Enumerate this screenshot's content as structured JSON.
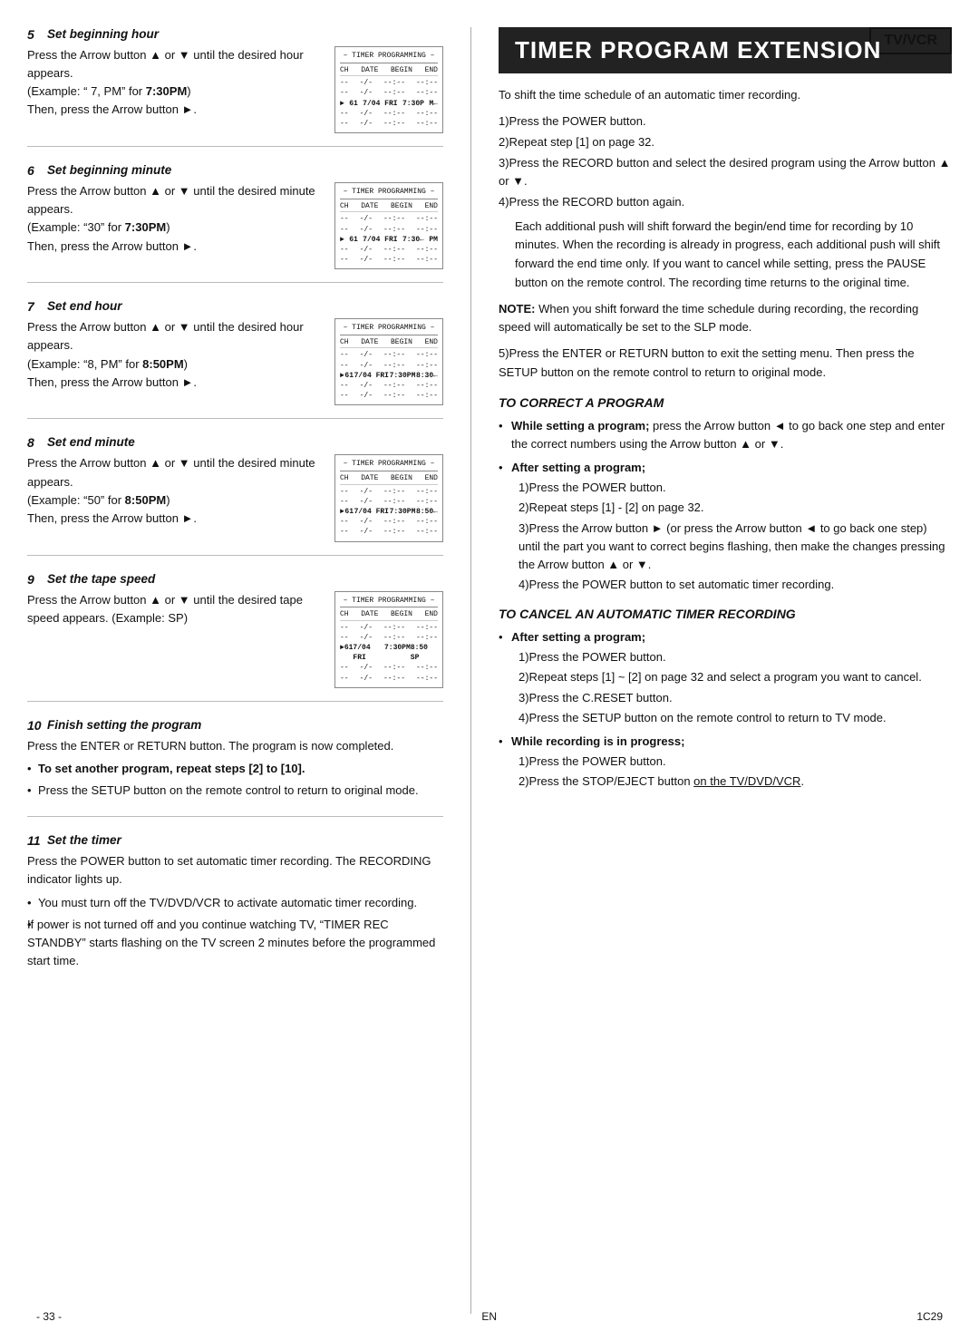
{
  "page": {
    "title": "TIMER PROGRAM EXTENSION",
    "badge": "TV/VCR",
    "page_number": "- 33 -",
    "language": "EN",
    "code": "1C29"
  },
  "left_column": {
    "steps": [
      {
        "num": "5",
        "title": "Set beginning hour",
        "text_lines": [
          "Press the Arrow button ▲ or ▼ until the desired hour appears.",
          "(Example: \" 7, PM\" for 7:30PM)",
          "Then, press the Arrow button ►."
        ],
        "screen": {
          "title": "– TIMER PROGRAMMING –",
          "header": [
            "CH",
            "DATE",
            "BEGIN",
            "END"
          ],
          "rows": [
            [
              "--",
              "-/-",
              "- -:- -",
              "- -:- -"
            ],
            [
              "--",
              "-/-",
              "- -:- -",
              "- -:- -"
            ],
            [
              "61",
              "7/04 FRI",
              "7:30P",
              "M ←"
            ],
            [
              "--",
              "-/-",
              "- -:- -",
              "- -:- -"
            ],
            [
              "--",
              "-/-",
              "- -:- -",
              "- -:- -"
            ]
          ],
          "highlighted_row": 2
        }
      },
      {
        "num": "6",
        "title": "Set beginning minute",
        "text_lines": [
          "Press the Arrow button ▲ or ▼ until the desired minute appears.",
          "(Example: \"30\" for 7:30PM)",
          "Then, press the Arrow button ►."
        ],
        "screen": {
          "title": "– TIMER PROGRAMMING –",
          "header": [
            "CH",
            "DATE",
            "BEGIN",
            "END"
          ],
          "rows": [
            [
              "--",
              "-/-",
              "- -:- -",
              "- -:- -"
            ],
            [
              "--",
              "-/-",
              "- -:- -",
              "- -:- -"
            ],
            [
              "61",
              "7/04 FRI",
              "7:30P",
              "M ←"
            ],
            [
              "--",
              "-/-",
              "- -:- -",
              "- -:- -"
            ],
            [
              "--",
              "-/-",
              "- -:- -",
              "- -:- -"
            ]
          ],
          "highlighted_row": 2
        }
      },
      {
        "num": "7",
        "title": "Set end hour",
        "text_lines": [
          "Press the Arrow button ▲ or ▼ until the desired hour appears.",
          "(Example: \"8, PM\" for 8:50PM)",
          "Then, press the Arrow button ►."
        ],
        "screen": {
          "title": "– TIMER PROGRAMMING –",
          "header": [
            "CH",
            "DATE",
            "BEGIN",
            "END"
          ],
          "rows": [
            [
              "--",
              "-/-",
              "- -:- -",
              "- -:- -"
            ],
            [
              "--",
              "-/-",
              "- -:- -",
              "- -:- -"
            ],
            [
              "61",
              "7/04 FRI",
              "7:30P",
              "M 8:30"
            ],
            [
              "--",
              "-/-",
              "- -:- -",
              "- -:- -"
            ],
            [
              "--",
              "-/-",
              "- -:- -",
              "- -:- -"
            ]
          ],
          "highlighted_row": 2
        }
      },
      {
        "num": "8",
        "title": "Set end minute",
        "text_lines": [
          "Press the Arrow button ▲ or ▼ until the desired minute appears.",
          "(Example: \"50\" for 8:50PM)",
          "Then, press the Arrow button ►."
        ],
        "screen": {
          "title": "– TIMER PROGRAMMING –",
          "header": [
            "CH",
            "DATE",
            "BEGIN",
            "END"
          ],
          "rows": [
            [
              "--",
              "-/-",
              "- -:- -",
              "- -:- -"
            ],
            [
              "--",
              "-/-",
              "- -:- -",
              "- -:- -"
            ],
            [
              "61",
              "7/04 FRI",
              "7:30P",
              "M 8:50"
            ],
            [
              "--",
              "-/-",
              "- -:- -",
              "- -:- -"
            ],
            [
              "--",
              "-/-",
              "- -:- -",
              "- -:- -"
            ]
          ],
          "highlighted_row": 2
        }
      },
      {
        "num": "9",
        "title": "Set the tape speed",
        "text_lines": [
          "Press the Arrow button ▲ or ▼ until the desired tape speed appears. (Example: SP)"
        ],
        "screen": {
          "title": "– TIMER PROGRAMMING –",
          "header": [
            "CH",
            "DATE",
            "BEGIN",
            "END"
          ],
          "rows": [
            [
              "--",
              "-/-",
              "- -:- -",
              "- -:- -"
            ],
            [
              "--",
              "-/-",
              "- -:- -",
              "- -:- -"
            ],
            [
              "61",
              "7/04 FRI",
              "7:30P",
              "M 8:50 SP"
            ],
            [
              "--",
              "-/-",
              "- -:- -",
              "- -:- -"
            ],
            [
              "--",
              "-/-",
              "- -:- -",
              "- -:- -"
            ]
          ],
          "highlighted_row": 2
        }
      }
    ],
    "step10": {
      "num": "10",
      "title": "Finish setting the program",
      "text": "Press the ENTER or RETURN button. The program is now completed.",
      "bullets": [
        "To set another program, repeat steps [2] to [10].",
        "Press the SETUP button on the remote control to return to original mode."
      ]
    },
    "step11": {
      "num": "11",
      "title": "Set the timer",
      "text": "Press the POWER button to set automatic timer recording. The RECORDING indicator lights up.",
      "bullets": [
        "You must turn off the TV/DVD/VCR to activate automatic timer recording.",
        "If power is not turned off and you continue watching TV, \"TIMER REC STANDBY\" starts flashing on the TV screen 2 minutes before the programmed start time."
      ]
    }
  },
  "right_column": {
    "intro_text": "To shift the time schedule of an automatic timer recording.",
    "numbered_steps": [
      "1)Press the POWER button.",
      "2)Repeat step [1] on page 32.",
      "3)Press the RECORD button and select the desired program using the Arrow button ▲ or ▼.",
      "4)Press the RECORD button again."
    ],
    "body_paragraph": "Each additional push will shift forward the begin/end time for recording by 10 minutes. When the recording is already in progress, each additional push will shift forward the end time only. If you want to cancel while setting, press the PAUSE button on the remote control. The recording time returns to the original time.",
    "note": "NOTE: When you shift forward the time schedule during recording, the recording speed will automatically be set to the SLP mode.",
    "step5_text": "5)Press the ENTER or RETURN button to exit the setting menu. Then press the SETUP button on the remote control to return to original mode.",
    "correct_program": {
      "heading": "TO CORRECT A PROGRAM",
      "bullets": [
        {
          "bold_part": "While setting a program;",
          "text": " press the Arrow button ◄ to go back one step and enter the correct numbers using the Arrow button ▲ or ▼."
        },
        {
          "bold_part": "After setting a program;",
          "text": "",
          "sub_steps": [
            "1)Press the POWER button.",
            "2)Repeat steps [1] - [2] on page 32.",
            "3)Press the Arrow button ► (or press the Arrow button ◄ to go back one step) until the part you want to correct begins flashing, then make the changes pressing the Arrow button ▲ or ▼.",
            "4)Press the POWER button to set automatic timer recording."
          ]
        }
      ]
    },
    "cancel_recording": {
      "heading": "TO CANCEL AN AUTOMATIC TIMER RECORDING",
      "bullets": [
        {
          "bold_part": "After setting a program;",
          "text": "",
          "sub_steps": [
            "1)Press the POWER button.",
            "2)Repeat steps [1] ~ [2] on page 32 and select a program you want to cancel.",
            "3)Press the C.RESET button.",
            "4)Press the SETUP button on the remote control to return to TV mode."
          ]
        },
        {
          "bold_part": "While recording is in progress;",
          "text": "",
          "sub_steps": [
            "1)Press the POWER button.",
            "2)Press the STOP/EJECT button on the TV/DVD/VCR."
          ]
        }
      ]
    }
  }
}
